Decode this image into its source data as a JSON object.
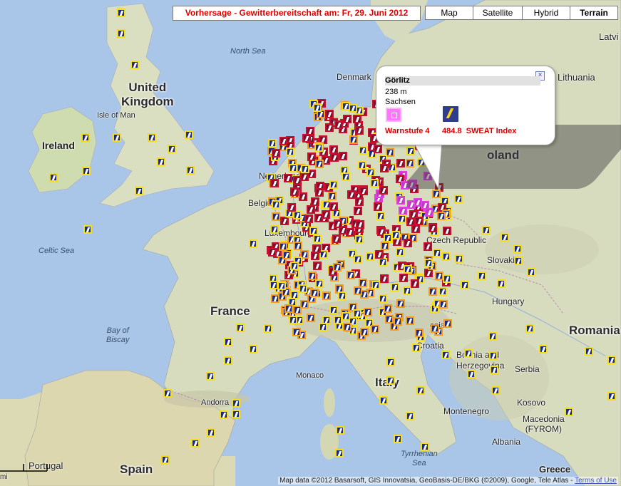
{
  "header": {
    "title": "Vorhersage - Gewitterbereitschaft am: Fr, 29. Juni 2012",
    "map_types": [
      {
        "label": "Map",
        "active": false
      },
      {
        "label": "Satellite",
        "active": false
      },
      {
        "label": "Hybrid",
        "active": false
      },
      {
        "label": "Terrain",
        "active": true
      }
    ]
  },
  "popup": {
    "place": "Görlitz",
    "altitude": "238 m",
    "region": "Sachsen",
    "warn_label": "Warnstufe 4",
    "sweat_value": "484.8",
    "sweat_label": "SWEAT Index",
    "warn_icon": "pink-square-icon",
    "sweat_icon": "lightning-icon",
    "close_icon": "close-icon"
  },
  "labels": {
    "countries": {
      "united_kingdom": "United\nKingdom",
      "ireland": "Ireland",
      "france": "France",
      "spain": "Spain",
      "italy": "Italy",
      "romania": "Romania",
      "lithuania": "Lithuania",
      "latvia": "Latvi",
      "poland": "oland",
      "denmark": "Denmark",
      "netherlands": "Netherland",
      "belgium": "Belgium",
      "luxembourg": "Luxembourg",
      "czech_republic": "Czech Republic",
      "slovakia": "Slovakia",
      "hungary": "Hungary",
      "croatia": "Croatia",
      "bosnia": "Bosnia and\nHerzegovina",
      "serbia": "Serbia",
      "kosovo": "Kosovo",
      "montenegro": "Montenegro",
      "macedonia": "Macedonia\n(FYROM)",
      "albania": "Albania",
      "greece": "Greece",
      "portugal": "Portugal",
      "andorra": "Andorra",
      "monaco": "Monaco",
      "isle_of_man": "Isle of Man",
      "slovenia": "enia"
    },
    "seas": {
      "north_sea": "North Sea",
      "celtic_sea": "Celtic Sea",
      "bay_of_biscay": "Bay of\nBiscay",
      "tyrrhenian_sea": "Tyrrhenian\nSea"
    }
  },
  "attribution": {
    "text": "Map data ©2012 Basarsoft, GIS Innovatsia, GeoBasis-DE/BKG (©2009), Google, Tele Atlas - ",
    "link": "Terms of Use"
  },
  "scale_label": "mi",
  "colors": {
    "sea": "#a9c6e8",
    "land": "#d8dcbf",
    "warn_title": "#e00000",
    "warn_text": "#d80000",
    "marker_level1_border": "#f5dd1a",
    "marker_level2_border": "#f39c1e",
    "marker_level3_border": "#c8102e",
    "marker_level4_border": "#e040e0"
  }
}
